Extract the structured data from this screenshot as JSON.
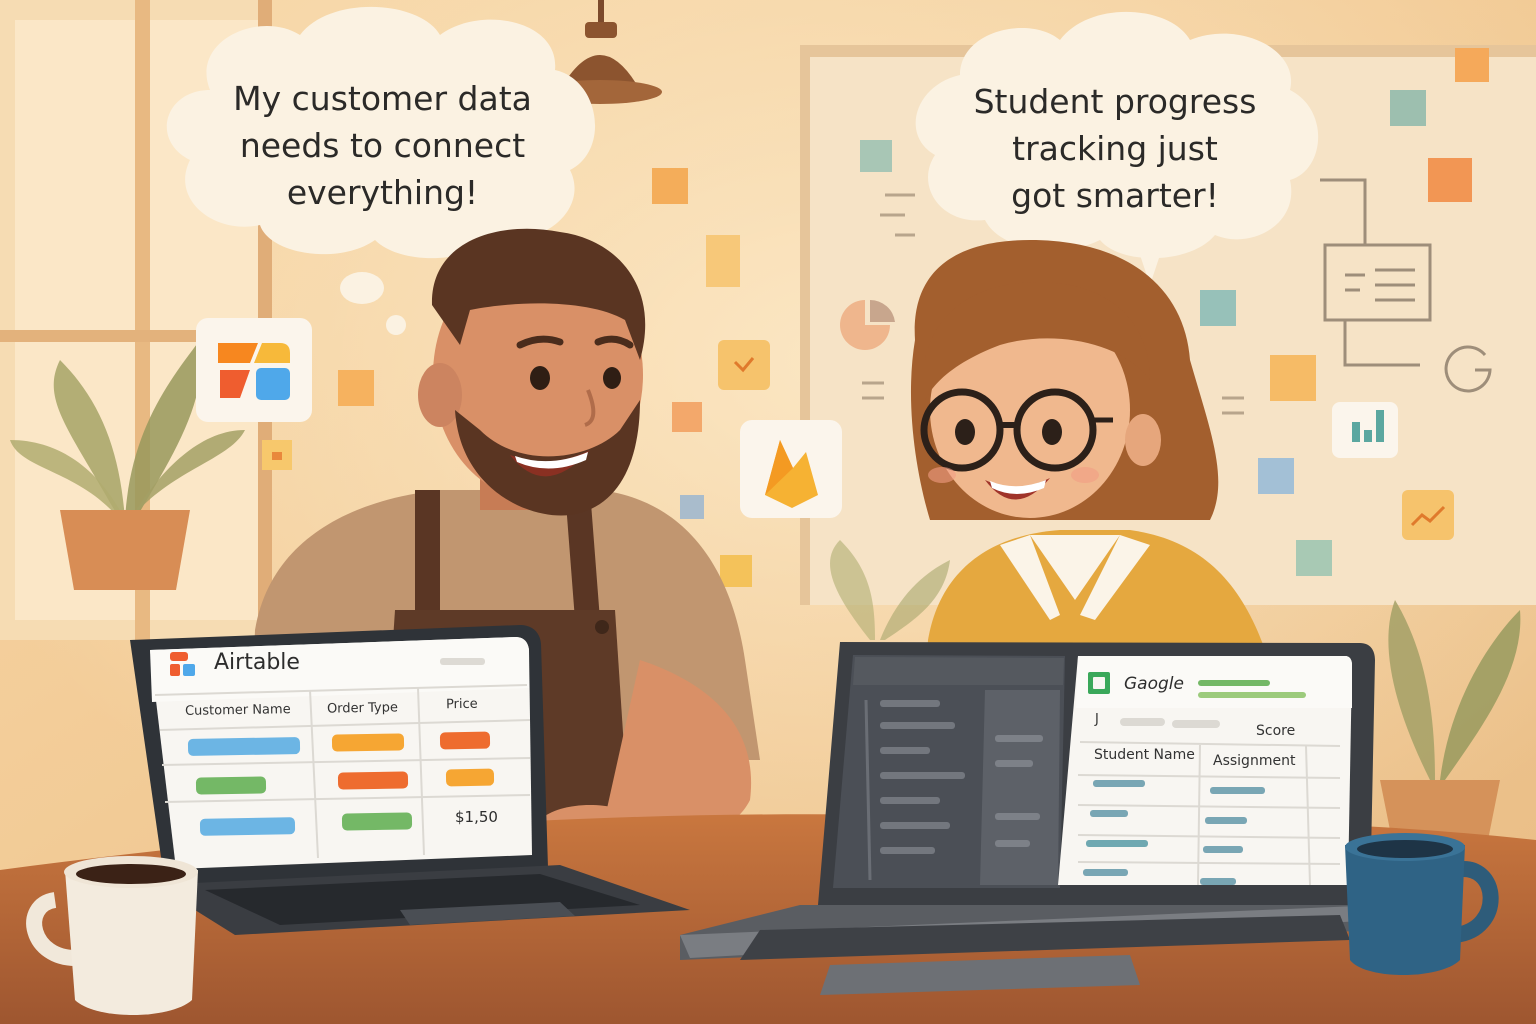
{
  "speech": {
    "left": [
      "My customer data",
      "needs to connect",
      "everything!"
    ],
    "right": [
      "Student progress",
      "tracking just",
      "got smarter!"
    ]
  },
  "airtable": {
    "title": "Airtable",
    "columns": [
      "Customer Name",
      "Order Type",
      "Price"
    ],
    "price_cell": "$1,50"
  },
  "google": {
    "title": "Gaogle",
    "score_label": "Score",
    "columns": [
      "Student Name",
      "Assignment"
    ],
    "stray_mark": "J"
  },
  "icons": [
    "airtable-logo-icon",
    "firebase-flame-icon",
    "bar-chart-icon",
    "check-note-icon",
    "trend-line-icon"
  ],
  "colors": {
    "wall": "#f3cf9c",
    "table": "#b86a3a",
    "bubble": "#fbf2e2",
    "blue_bar": "#6cb5e4",
    "orange_bar": "#f39b2b",
    "green_bar": "#74b866",
    "teal_bar": "#79a6b4"
  }
}
